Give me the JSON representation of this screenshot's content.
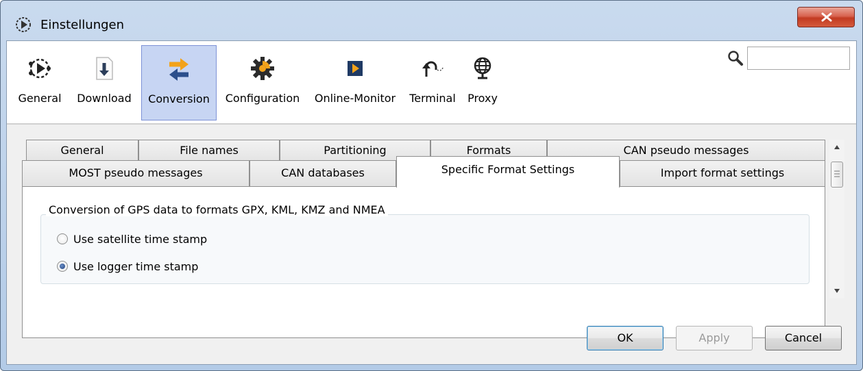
{
  "window": {
    "title": "Einstellungen",
    "close_icon": "close-icon"
  },
  "toolbar": {
    "items": [
      {
        "label": "General",
        "icon": "network-gear-icon",
        "active": false
      },
      {
        "label": "Download",
        "icon": "download-icon",
        "active": false
      },
      {
        "label": "Conversion",
        "icon": "convert-arrows-icon",
        "active": true
      },
      {
        "label": "Configuration",
        "icon": "gear-icon",
        "active": false
      },
      {
        "label": "Online-Monitor",
        "icon": "play-icon",
        "active": false
      },
      {
        "label": "Terminal",
        "icon": "terminal-arrow-icon",
        "active": false
      },
      {
        "label": "Proxy",
        "icon": "globe-monitor-icon",
        "active": false
      }
    ],
    "search": {
      "icon": "search-icon",
      "value": "",
      "placeholder": ""
    }
  },
  "tabs": {
    "row_back": [
      "General",
      "File names",
      "Partitioning",
      "Formats",
      "CAN pseudo messages"
    ],
    "row_front": [
      "MOST pseudo messages",
      "CAN databases",
      "Specific Format Settings",
      "Import format settings"
    ],
    "selected": "Specific Format Settings"
  },
  "panel": {
    "group_title": "Conversion of GPS data to formats GPX, KML, KMZ and NMEA",
    "options": [
      {
        "label": "Use satellite time stamp",
        "checked": false
      },
      {
        "label": "Use logger time stamp",
        "checked": true
      }
    ]
  },
  "buttons": {
    "ok": "OK",
    "apply": "Apply",
    "cancel": "Cancel"
  },
  "colors": {
    "accent_selected": "#c7d5f3",
    "close_red": "#c23b22",
    "conversion_orange": "#f2a21b",
    "conversion_blue": "#2c4f8c"
  }
}
